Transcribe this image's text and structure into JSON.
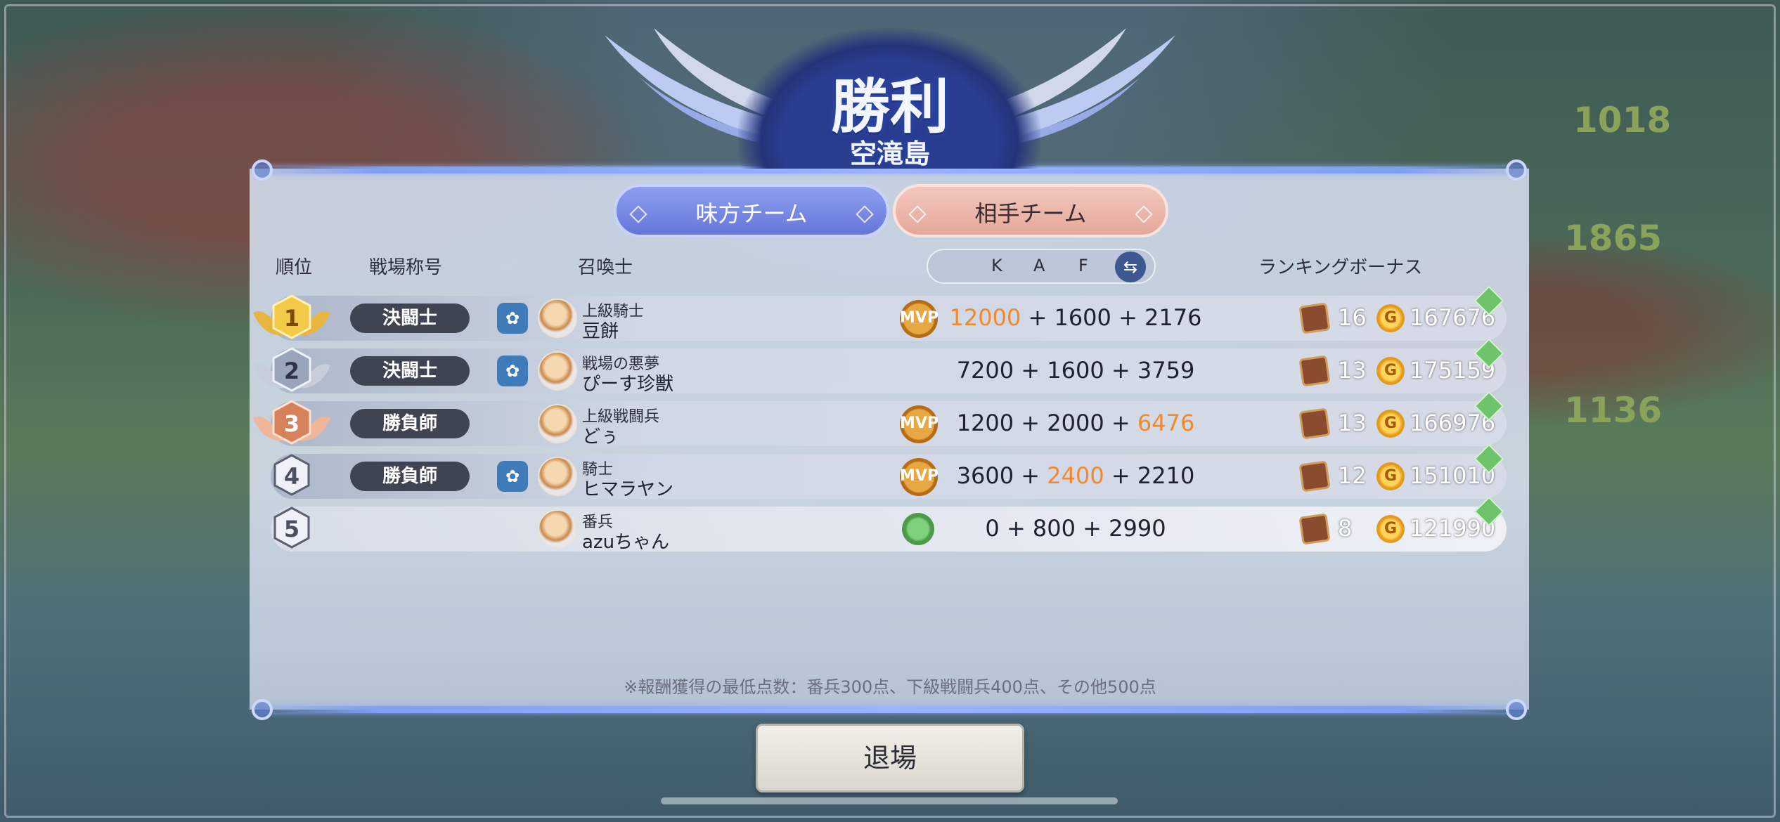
{
  "header": {
    "title": "勝利",
    "stage": "空滝島"
  },
  "scene_numbers": [
    "1018",
    "1865",
    "1136"
  ],
  "tabs": {
    "ally": "味方チーム",
    "enemy": "相手チーム"
  },
  "columns": {
    "rank": "順位",
    "battle_title": "戦場称号",
    "summoner": "召喚士",
    "k": "K",
    "a": "A",
    "f": "F",
    "bonus": "ランキングボーナス"
  },
  "rows": [
    {
      "rank": "1",
      "battle_title": "決闘士",
      "rank_title": "上級騎士",
      "name": "豆餅",
      "k": "12000",
      "a": "1600",
      "f": "2176",
      "chests": "16",
      "gold": "167676"
    },
    {
      "rank": "2",
      "battle_title": "決闘士",
      "rank_title": "戦場の悪夢",
      "name": "ぴーす珍獣",
      "k": "7200",
      "a": "1600",
      "f": "3759",
      "chests": "13",
      "gold": "175159"
    },
    {
      "rank": "3",
      "battle_title": "勝負師",
      "rank_title": "上級戦闘兵",
      "name": "どぅ",
      "k": "1200",
      "a": "2000",
      "f": "6476",
      "chests": "13",
      "gold": "166976"
    },
    {
      "rank": "4",
      "battle_title": "勝負師",
      "rank_title": "騎士",
      "name": "ヒマラヤン",
      "k": "3600",
      "a": "2400",
      "f": "2210",
      "chests": "12",
      "gold": "151010"
    },
    {
      "rank": "5",
      "battle_title": "",
      "rank_title": "番兵",
      "name": "azuちゃん",
      "k": "0",
      "a": "800",
      "f": "2990",
      "chests": "8",
      "gold": "121990"
    }
  ],
  "badges": {
    "mvp": "MVP",
    "coin": "G"
  },
  "plus": "+",
  "note": "※報酬獲得の最低点数：番兵300点、下級戦闘兵400点、その他500点",
  "exit_button": "退場",
  "colors": {
    "highlight": "#f08a2c",
    "ally_tab": "#6576d8",
    "enemy_tab": "#e4a89a"
  }
}
